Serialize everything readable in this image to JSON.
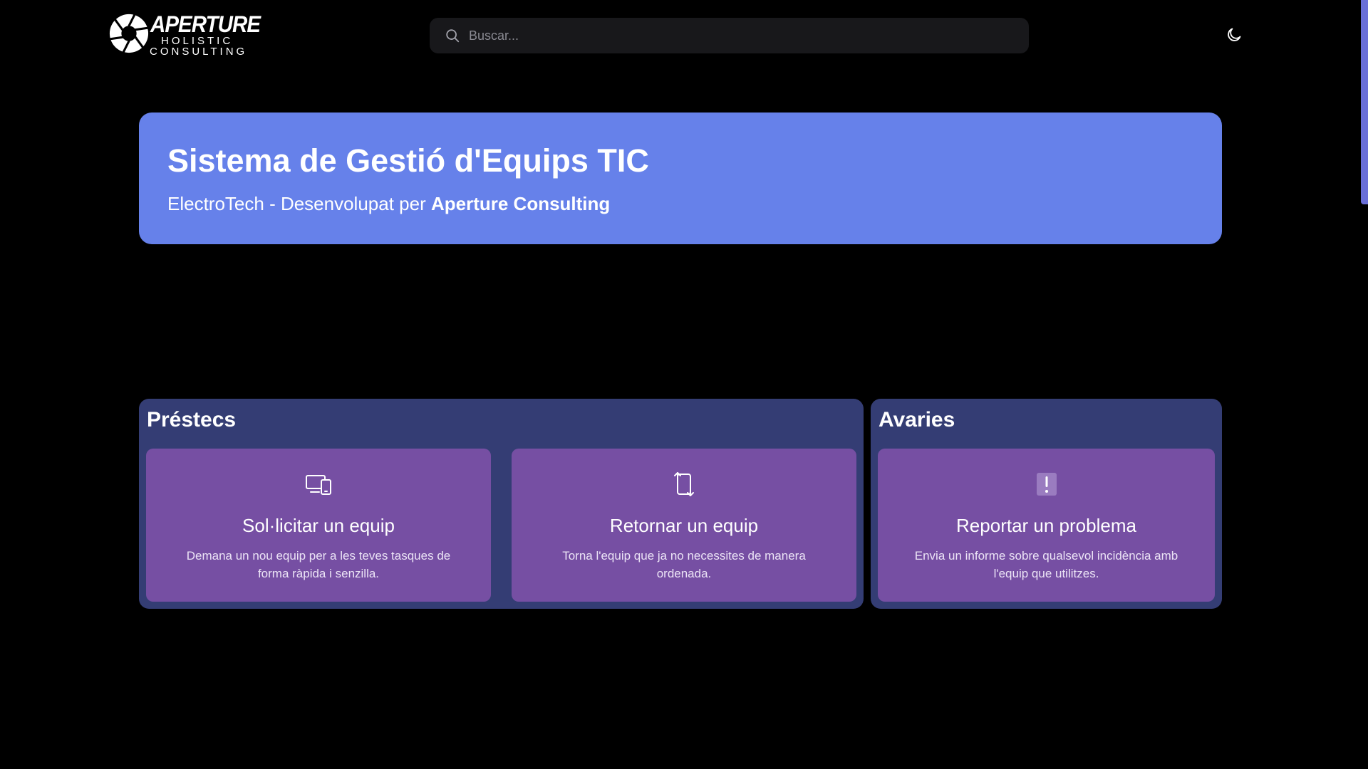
{
  "header": {
    "logo": {
      "word": "APERTURE",
      "line1": "HOLISTIC",
      "line2": "CONSULTING"
    },
    "search": {
      "placeholder": "Buscar..."
    },
    "icons": {
      "search": "search-icon",
      "theme": "moon-icon"
    }
  },
  "hero": {
    "title": "Sistema de Gestió d'Equips TIC",
    "subtitle_prefix": "ElectroTech - Desenvolupat per ",
    "subtitle_strong": "Aperture Consulting"
  },
  "sections": {
    "prestecs": {
      "title": "Préstecs",
      "cards": [
        {
          "icon": "devices-icon",
          "title": "Sol·licitar un equip",
          "description": "Demana un nou equip per a les teves tasques de forma ràpida i senzilla."
        },
        {
          "icon": "return-device-icon",
          "title": "Retornar un equip",
          "description": "Torna l'equip que ja no necessites de manera ordenada."
        }
      ]
    },
    "avaries": {
      "title": "Avaries",
      "cards": [
        {
          "icon": "alert-icon",
          "title": "Reportar un problema",
          "description": "Envia un informe sobre qualsevol incidència amb l'equip que utilitzes."
        }
      ]
    }
  },
  "colors": {
    "background": "#000000",
    "hero": "#6681ea",
    "section": "#343d74",
    "card": "#764fa3",
    "search": "#18181b",
    "scrollbar": "#6a6fd8"
  }
}
